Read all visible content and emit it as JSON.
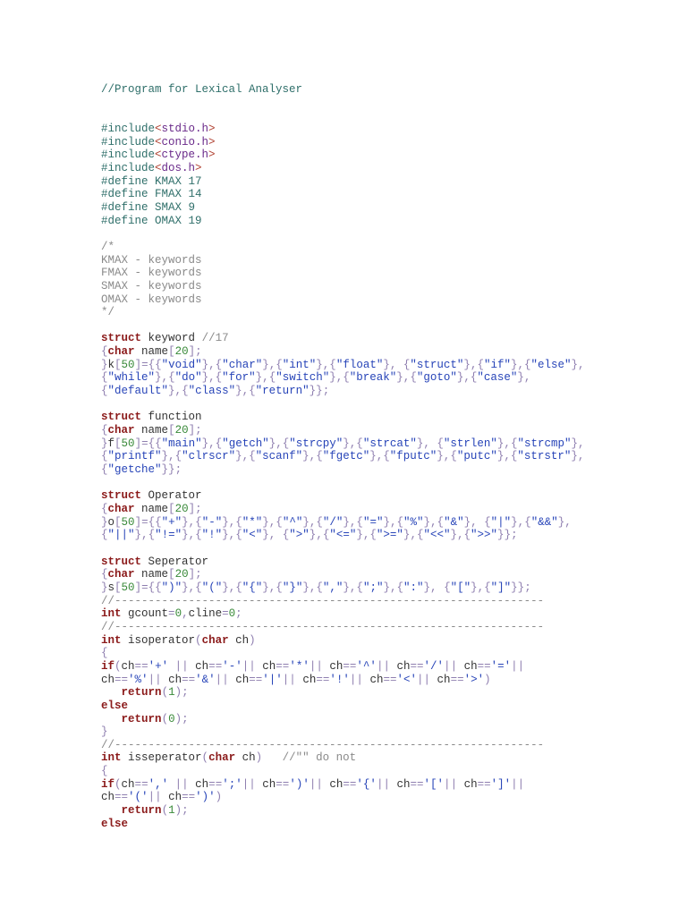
{
  "document": {
    "lines": [
      "//Program for Lexical Analyser",
      "",
      "",
      "#include<stdio.h>",
      "#include<conio.h>",
      "#include<ctype.h>",
      "#include<dos.h>",
      "#define KMAX 17",
      "#define FMAX 14",
      "#define SMAX 9",
      "#define OMAX 19",
      "",
      "/*",
      "KMAX - keywords",
      "FMAX - keywords",
      "SMAX - keywords",
      "OMAX - keywords",
      "*/",
      "",
      "struct keyword //17",
      "{char name[20];",
      "}k[50]={{\"void\"},{\"char\"},{\"int\"},{\"float\"}, {\"struct\"},{\"if\"},{\"else\"},",
      "{\"while\"},{\"do\"},{\"for\"},{\"switch\"},{\"break\"},{\"goto\"},{\"case\"},",
      "{\"default\"},{\"class\"},{\"return\"}};",
      "",
      "struct function",
      "{char name[20];",
      "}f[50]={{\"main\"},{\"getch\"},{\"strcpy\"},{\"strcat\"}, {\"strlen\"},{\"strcmp\"},",
      "{\"printf\"},{\"clrscr\"},{\"scanf\"},{\"fgetc\"},{\"fputc\"},{\"putc\"},{\"strstr\"},",
      "{\"getche\"}};",
      "",
      "struct Operator",
      "{char name[20];",
      "}o[50]={{\"+\"},{\"-\"},{\"*\"},{\"^\"},{\"/\"},{\"=\"},{\"%\"},{\"&\"}, {\"|\"},{\"&&\"},",
      "{\"||\"},{\"!=\"},{\"!\"},{\"<\"}, {\">\"},{\"<=\"},{\">=\"},{\"<<\"},{\">>\"}};",
      "",
      "struct Seperator",
      "{char name[20];",
      "}s[50]={{\")\"},{\"(\"},{\"{\"},{\"}\"},{\",\"},{\";\"},{\":\"}, {\"[\"},{\"]\"}};",
      "//----------------------------------------------------------------",
      "int gcount=0,cline=0;",
      "//----------------------------------------------------------------",
      "int isoperator(char ch)",
      "{",
      "if(ch=='+' || ch=='-'|| ch=='*'|| ch=='^'|| ch=='/'|| ch=='='||",
      "ch=='%'|| ch=='&'|| ch=='|'|| ch=='!'|| ch=='<'|| ch=='>')",
      "   return(1);",
      "else",
      "   return(0);",
      "}",
      "//----------------------------------------------------------------",
      "int isseperator(char ch)   //\"\" do not",
      "{",
      "if(ch==',' || ch==';'|| ch==')'|| ch=='{'|| ch=='['|| ch==']'||",
      "ch=='('|| ch==')')",
      "   return(1);",
      "else"
    ]
  },
  "colors": {
    "keyword": "#8b1a1a",
    "string": "#2744b8",
    "number": "#3a8a3a",
    "comment": "#8a8a8a",
    "preprocessor": "#2f6f6a"
  }
}
